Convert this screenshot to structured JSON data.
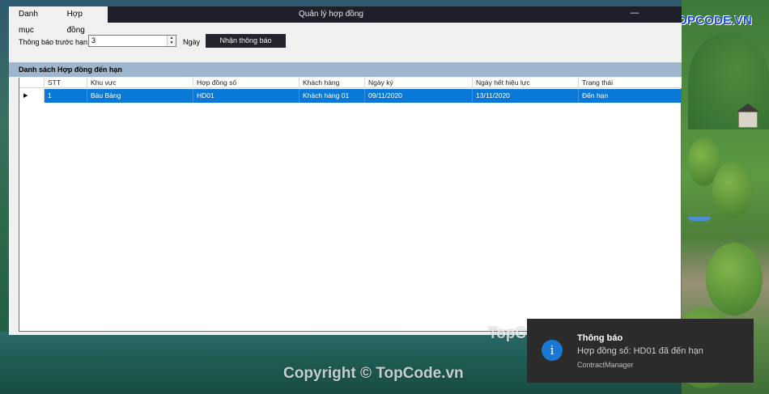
{
  "window": {
    "title": "Quản lý hợp đồng",
    "minimize_glyph": "—",
    "close_glyph": "✕"
  },
  "menu": {
    "items": [
      {
        "label": "Danh mục"
      },
      {
        "label": "Hợp đồng"
      }
    ]
  },
  "toolbar": {
    "days_before_label": "Thông báo trước hạn:",
    "days_before_value": "3",
    "days_unit": "Ngày",
    "notify_button": "Nhận thông báo"
  },
  "section": {
    "title": "Danh sách Hợp đồng đến hạn"
  },
  "grid": {
    "columns": [
      "STT",
      "Khu vực",
      "Hợp đồng số",
      "Khách hàng",
      "Ngày ký",
      "Ngày hết hiệu lực",
      "Trạng thái"
    ],
    "rows": [
      [
        "1",
        "Bàu Bàng",
        "HD01",
        "Khách hàng 01",
        "09/11/2020",
        "13/11/2020",
        "Đến hạn"
      ]
    ],
    "current_row_glyph": "▶",
    "selection_color": "#0a78d7"
  },
  "toast": {
    "icon": "info-icon",
    "title": "Thông báo",
    "body": "Hợp đồng số: HD01 đã đến hạn",
    "app": "ContractManager",
    "background": "#2b2b2b"
  },
  "watermarks": {
    "logo": "TOPCODE.VN",
    "mid": "TopCode.vn",
    "copyright": "Copyright © TopCode.vn"
  }
}
